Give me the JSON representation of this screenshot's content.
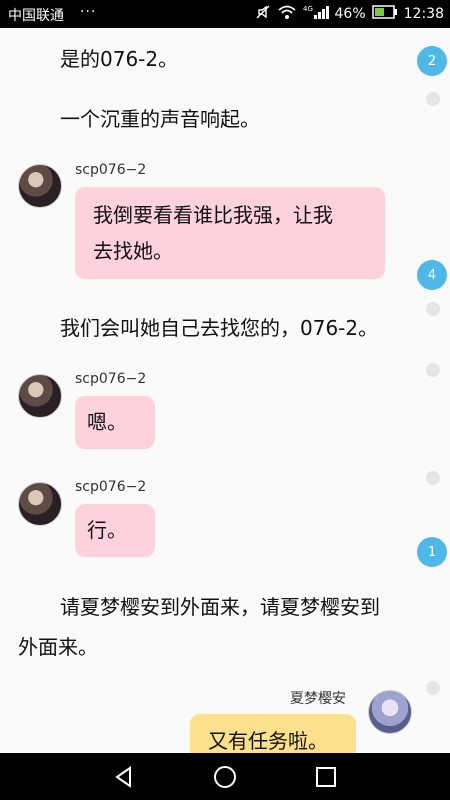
{
  "status": {
    "carrier": "中国联通",
    "dots": "···",
    "network": "4G",
    "battery": "46%",
    "time": "12:38"
  },
  "chat": {
    "narration": [
      "是的076-2。",
      "一个沉重的声音响起。",
      "我们会叫她自己去找您的，076-2。",
      "请夏梦樱安到外面来，请夏梦樱安到",
      "外面来。"
    ],
    "messages": [
      {
        "sender": "scp076−2",
        "text_line1": "我倒要看看谁比我强，让我",
        "text_line2": "去找她。"
      },
      {
        "sender": "scp076−2",
        "text": "嗯。"
      },
      {
        "sender": "scp076−2",
        "text": "行。"
      },
      {
        "sender": "夏梦樱安",
        "text": "又有任务啦。"
      }
    ],
    "badges": [
      "2",
      "4",
      "1"
    ]
  },
  "colors": {
    "bubble_pink": "#fdd2dc",
    "bubble_yellow": "#fde08d",
    "badge_blue": "#4fb8e6"
  },
  "icons": {
    "back": "triangle-back-icon",
    "home": "circle-home-icon",
    "recent": "square-recent-icon"
  }
}
